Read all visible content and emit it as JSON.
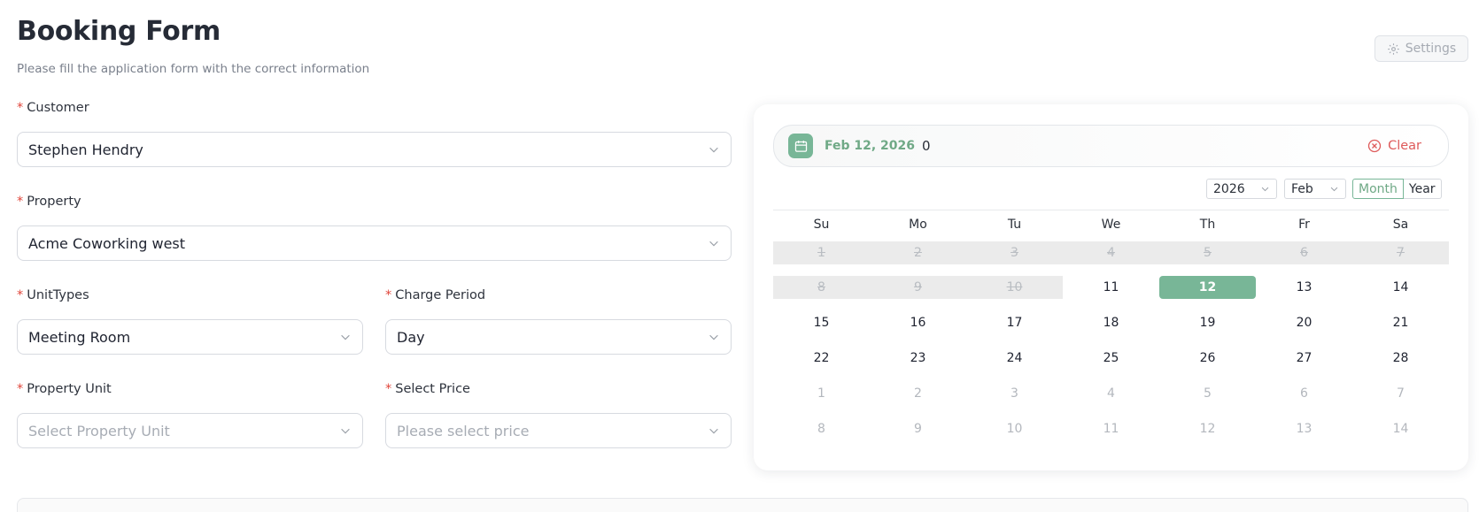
{
  "header": {
    "title": "Booking Form",
    "subtitle": "Please fill the application form with the correct information",
    "settings_label": "Settings"
  },
  "form": {
    "customer": {
      "label": "Customer",
      "value": "Stephen Hendry"
    },
    "property": {
      "label": "Property",
      "value": "Acme Coworking west"
    },
    "unit_types": {
      "label": "UnitTypes",
      "value": "Meeting Room"
    },
    "charge_period": {
      "label": "Charge Period",
      "value": "Day"
    },
    "property_unit": {
      "label": "Property Unit",
      "placeholder": "Select Property Unit"
    },
    "select_price": {
      "label": "Select Price",
      "placeholder": "Please select price"
    },
    "required_mark": "*"
  },
  "calendar": {
    "selected_date": "Feb 12, 2026",
    "count": "0",
    "clear_label": "Clear",
    "year_select": "2026",
    "month_select": "Feb",
    "mode_month": "Month",
    "mode_year": "Year",
    "weekdays": [
      "Su",
      "Mo",
      "Tu",
      "We",
      "Th",
      "Fr",
      "Sa"
    ],
    "weeks": [
      [
        "1",
        "2",
        "3",
        "4",
        "5",
        "6",
        "7"
      ],
      [
        "8",
        "9",
        "10",
        "11",
        "12",
        "13",
        "14"
      ],
      [
        "15",
        "16",
        "17",
        "18",
        "19",
        "20",
        "21"
      ],
      [
        "22",
        "23",
        "24",
        "25",
        "26",
        "27",
        "28"
      ],
      [
        "1",
        "2",
        "3",
        "4",
        "5",
        "6",
        "7"
      ],
      [
        "8",
        "9",
        "10",
        "11",
        "12",
        "13",
        "14"
      ]
    ]
  },
  "colors": {
    "accent": "#78b697",
    "required": "#e0453a",
    "clear": "#de5a5a"
  }
}
